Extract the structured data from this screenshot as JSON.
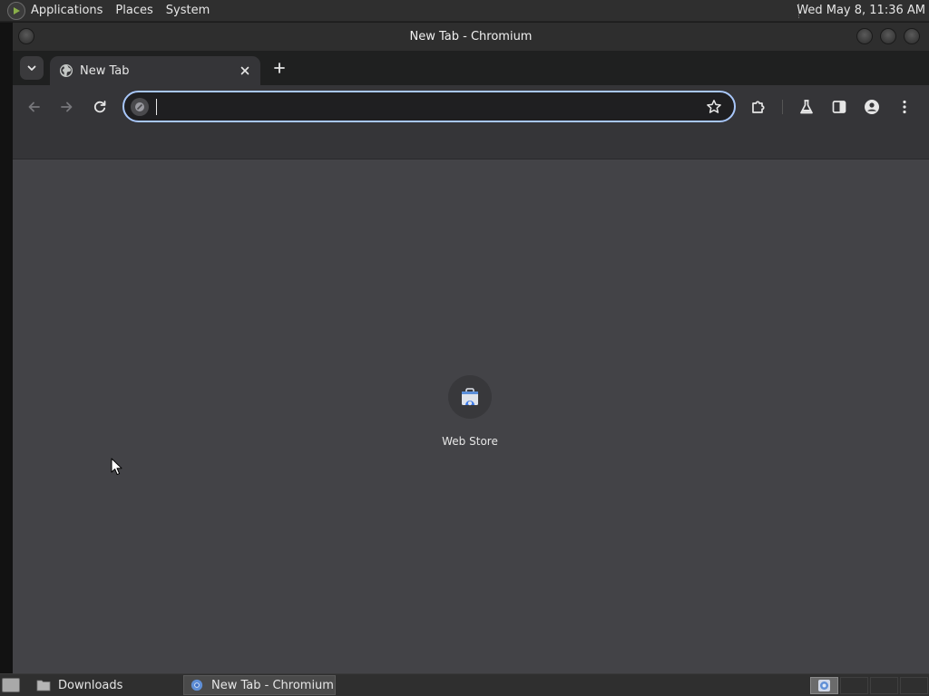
{
  "top_panel": {
    "menus": [
      "Applications",
      "Places",
      "System"
    ],
    "clock": "Wed May  8, 11:36 AM"
  },
  "window": {
    "title": "New Tab - Chromium"
  },
  "tabs": [
    {
      "title": "New Tab",
      "icon": "globe-icon",
      "active": true
    }
  ],
  "omnibox": {
    "value": "",
    "placeholder": ""
  },
  "content": {
    "shortcuts": [
      {
        "label": "Web Store",
        "icon": "web-store-icon"
      }
    ]
  },
  "taskbar": {
    "tasks": [
      {
        "label": "Downloads",
        "icon": "folder-icon",
        "active": false
      },
      {
        "label": "New Tab - Chromium",
        "icon": "chromium-icon",
        "active": true
      }
    ],
    "active_workspace": 1
  },
  "colors": {
    "omnibox_focus": "#a8c7fa",
    "content_bg": "#434347",
    "toolbar_bg": "#353538"
  }
}
